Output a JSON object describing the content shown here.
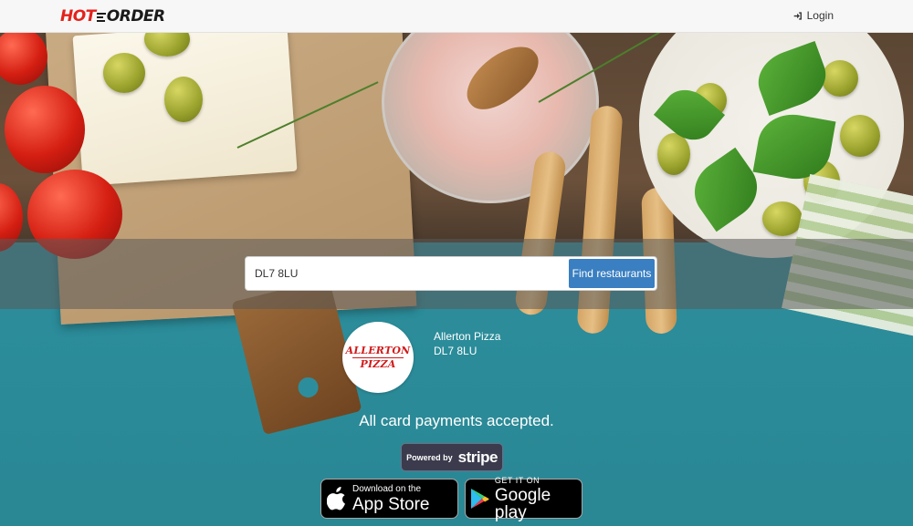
{
  "nav": {
    "logo_part1": "HOT",
    "logo_part2": "ORDER",
    "login_label": "Login",
    "login_icon": "sign-in-icon"
  },
  "search": {
    "value": "DL7 8LU",
    "button_label": "Find restaurants"
  },
  "restaurant": {
    "logo_line1": "ALLERTON",
    "logo_line2": "PIZZA",
    "name": "Allerton Pizza",
    "postcode": "DL7 8LU"
  },
  "payments_text": "All card payments accepted.",
  "stripe": {
    "prefix": "Powered by",
    "brand": "stripe"
  },
  "app_store": {
    "small": "Download on the",
    "big": "App Store"
  },
  "google_play": {
    "small": "GET IT ON",
    "big": "Google play"
  },
  "colors": {
    "brand_red": "#e3211c",
    "button_blue": "#3a7fc1",
    "background_teal": "#2e8a98"
  }
}
